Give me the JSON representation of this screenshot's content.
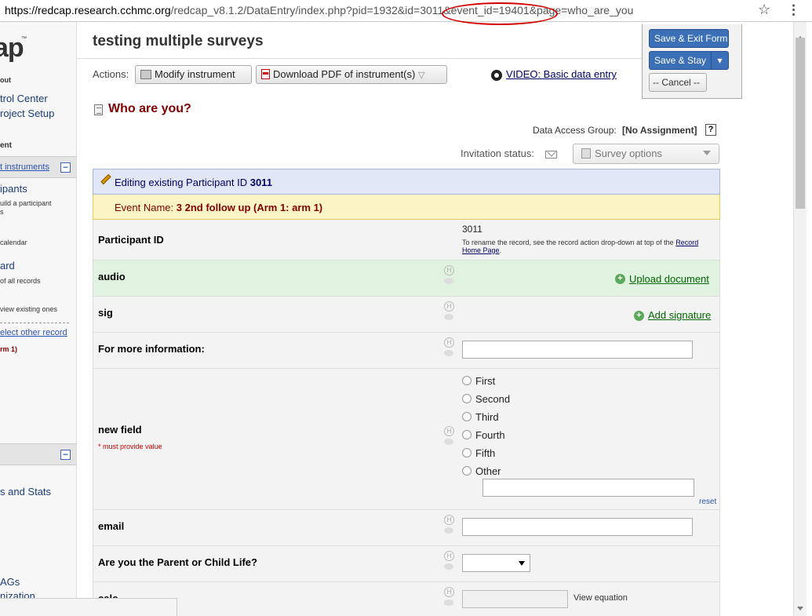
{
  "browser": {
    "url_host": "https://redcap.research.cchmc.org",
    "url_path": "/redcap_v8.1.2/DataEntry/index.php?pid=1932&id=3011&event_id=19401&page=who_are_you"
  },
  "sidebar": {
    "logo": "ap",
    "logo_tm": "™",
    "logout": "out",
    "control_center": "trol Center",
    "project_setup": "roject Setup",
    "section_header": "ent",
    "instruments_link": "t instruments",
    "participants": "ipants",
    "participants_note": "uild a participant",
    "participants_note2": "s",
    "calendar": "calendar",
    "dashboard": "ard",
    "all_records": "of all records",
    "view_existing": "view existing ones",
    "select_other": "elect other record",
    "arm": "rm 1)",
    "stats": "s and Stats",
    "dags": "AGs",
    "customization": "nization"
  },
  "header": {
    "title": "testing multiple surveys",
    "actions_label": "Actions:",
    "modify_label": "Modify instrument",
    "pdf_label": "Download PDF of instrument(s)",
    "pdf_caret": "▽",
    "video_label": "VIDEO: Basic data entry"
  },
  "save_panel": {
    "save_exit": "Save & Exit Form",
    "save_stay": "Save & Stay",
    "cancel": "-- Cancel --"
  },
  "form": {
    "title": "Who are you?",
    "dag_label": "Data Access Group:",
    "dag_value": "[No Assignment]",
    "help": "?",
    "invitation_label": "Invitation status:",
    "survey_options": "Survey options",
    "edit_prefix": "Editing existing Participant ID",
    "edit_id": "3011",
    "event_prefix": "Event Name:",
    "event_name": "3 2nd follow up (Arm 1: arm 1)"
  },
  "fields": {
    "participant_id": {
      "label": "Participant ID",
      "value": "3011",
      "note": "To rename the record, see the record action drop-down at top of the",
      "note_link": "Record Home Page",
      "note_end": "."
    },
    "audio": {
      "label": "audio",
      "action": "Upload document"
    },
    "sig": {
      "label": "sig",
      "action": "Add signature"
    },
    "more_info": {
      "label": "For more information:"
    },
    "new_field": {
      "label": "new field",
      "required": "* must provide value",
      "options": [
        "First",
        "Second",
        "Third",
        "Fourth",
        "Fifth",
        "Other"
      ],
      "reset": "reset"
    },
    "email": {
      "label": "email"
    },
    "parent_child": {
      "label": "Are you the Parent or Child Life?"
    },
    "calc": {
      "label": "calc",
      "view_equation": "View equation"
    }
  },
  "icons": {
    "field_history": "H"
  },
  "colors": {
    "form_title": "#800000",
    "primary_button": "#3b6fb6",
    "edit_bar": "#e1e7f7",
    "event_bar": "#fcf4c4",
    "file_row": "#e0f3e0",
    "action_link": "#006600",
    "highlight_ellipse": "#d40000"
  }
}
